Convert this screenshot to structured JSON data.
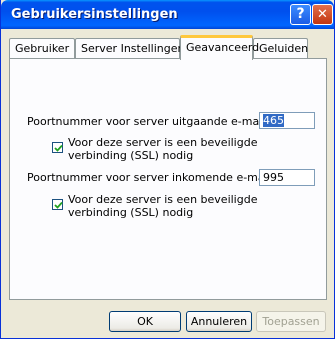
{
  "window": {
    "title": "Gebruikersinstellingen",
    "help_glyph": "?",
    "close_glyph": "✕"
  },
  "tabs": [
    {
      "label": "Gebruiker",
      "active": false
    },
    {
      "label": "Server Instellingen",
      "active": false
    },
    {
      "label": "Geavanceerd",
      "active": true
    },
    {
      "label": "Geluiden",
      "active": false
    }
  ],
  "outgoing": {
    "port_label": "Poortnummer voor server uitgaande e-mail:",
    "port_value": "465",
    "ssl_label_line1": "Voor deze server is een beveiligde",
    "ssl_label_line2": "verbinding (SSL) nodig",
    "ssl_checked": true
  },
  "incoming": {
    "port_label": "Poortnummer voor server inkomende e-mail:",
    "port_value": "995",
    "ssl_label_line1": "Voor deze server is een beveiligde",
    "ssl_label_line2": "verbinding (SSL) nodig",
    "ssl_checked": true
  },
  "buttons": {
    "ok": "OK",
    "cancel": "Annuleren",
    "apply": "Toepassen"
  }
}
